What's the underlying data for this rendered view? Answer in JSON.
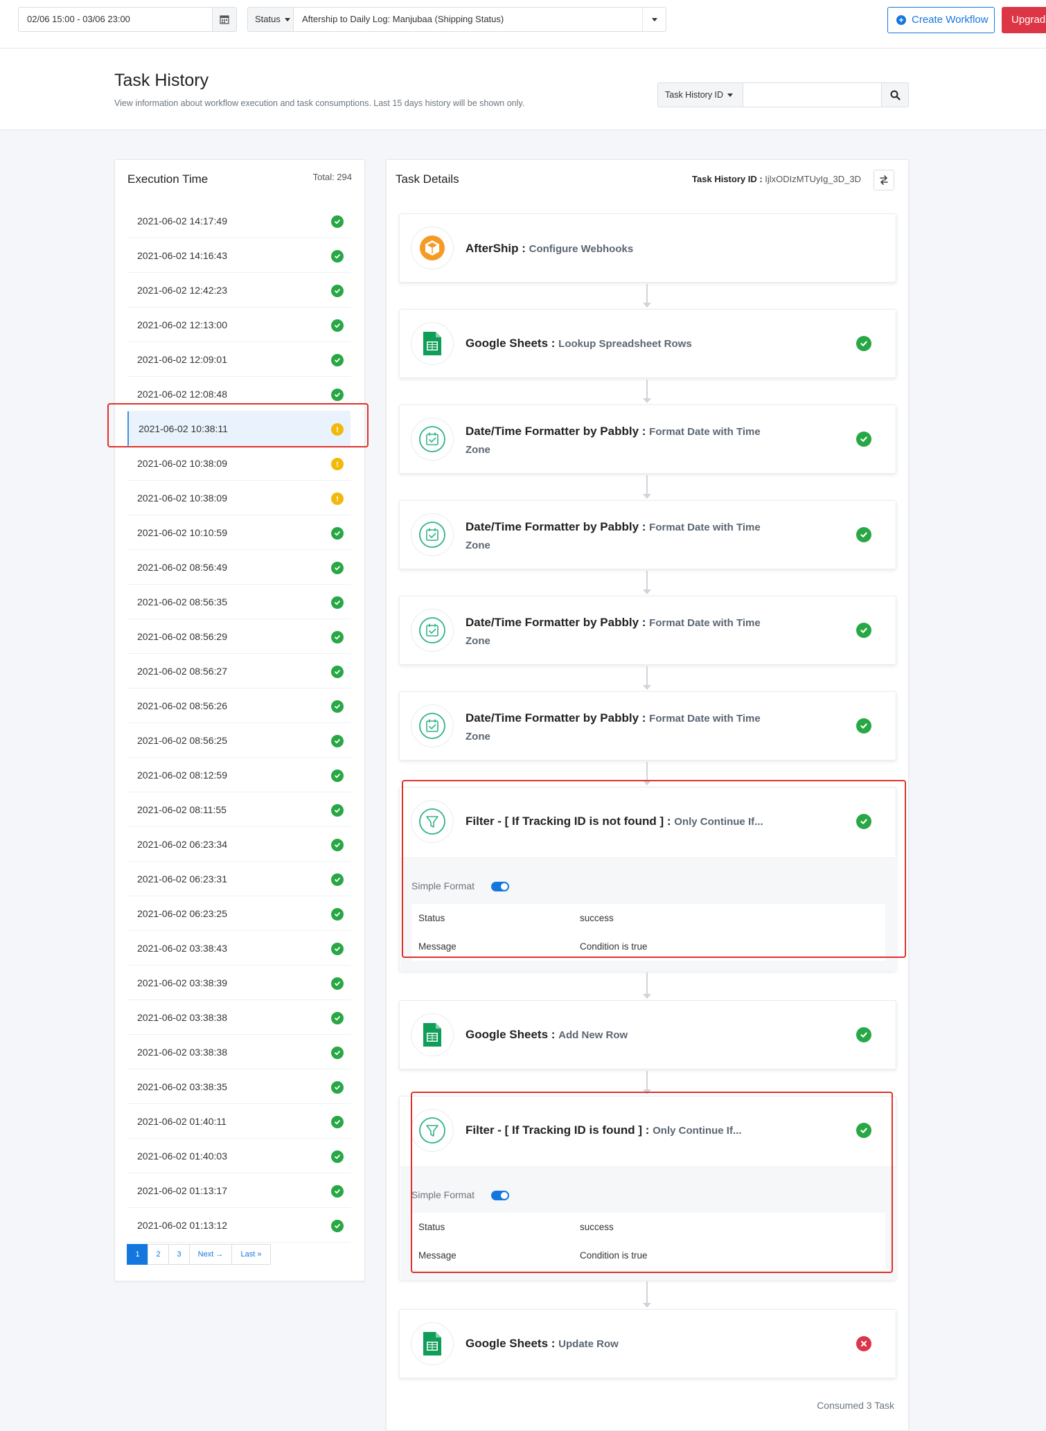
{
  "topbar": {
    "date_range": "02/06 15:00 - 03/06 23:00",
    "status_label": "Status",
    "workflow_selected": "Aftership to Daily Log: Manjubaa (Shipping Status)",
    "create_workflow_label": "Create Workflow",
    "upgrade_label": "Upgrad"
  },
  "header": {
    "title": "Task History",
    "subtitle": "View information about workflow execution and task consumptions. Last 15 days history will be shown only.",
    "search_type_label": "Task History ID",
    "search_value": ""
  },
  "executions": {
    "title": "Execution Time",
    "total": "Total: 294",
    "rows": [
      {
        "time": "2021-06-02 14:17:49",
        "status": "success"
      },
      {
        "time": "2021-06-02 14:16:43",
        "status": "success"
      },
      {
        "time": "2021-06-02 12:42:23",
        "status": "success"
      },
      {
        "time": "2021-06-02 12:13:00",
        "status": "success"
      },
      {
        "time": "2021-06-02 12:09:01",
        "status": "success"
      },
      {
        "time": "2021-06-02 12:08:48",
        "status": "success"
      },
      {
        "time": "2021-06-02 10:38:11",
        "status": "warning",
        "selected": true
      },
      {
        "time": "2021-06-02 10:38:09",
        "status": "warning"
      },
      {
        "time": "2021-06-02 10:38:09",
        "status": "warning"
      },
      {
        "time": "2021-06-02 10:10:59",
        "status": "success"
      },
      {
        "time": "2021-06-02 08:56:49",
        "status": "success"
      },
      {
        "time": "2021-06-02 08:56:35",
        "status": "success"
      },
      {
        "time": "2021-06-02 08:56:29",
        "status": "success"
      },
      {
        "time": "2021-06-02 08:56:27",
        "status": "success"
      },
      {
        "time": "2021-06-02 08:56:26",
        "status": "success"
      },
      {
        "time": "2021-06-02 08:56:25",
        "status": "success"
      },
      {
        "time": "2021-06-02 08:12:59",
        "status": "success"
      },
      {
        "time": "2021-06-02 08:11:55",
        "status": "success"
      },
      {
        "time": "2021-06-02 06:23:34",
        "status": "success"
      },
      {
        "time": "2021-06-02 06:23:31",
        "status": "success"
      },
      {
        "time": "2021-06-02 06:23:25",
        "status": "success"
      },
      {
        "time": "2021-06-02 03:38:43",
        "status": "success"
      },
      {
        "time": "2021-06-02 03:38:39",
        "status": "success"
      },
      {
        "time": "2021-06-02 03:38:38",
        "status": "success"
      },
      {
        "time": "2021-06-02 03:38:38",
        "status": "success"
      },
      {
        "time": "2021-06-02 03:38:35",
        "status": "success"
      },
      {
        "time": "2021-06-02 01:40:11",
        "status": "success"
      },
      {
        "time": "2021-06-02 01:40:03",
        "status": "success"
      },
      {
        "time": "2021-06-02 01:13:17",
        "status": "success"
      },
      {
        "time": "2021-06-02 01:13:12",
        "status": "success"
      }
    ],
    "pagination": {
      "pages": [
        "1",
        "2",
        "3"
      ],
      "active": "1",
      "next_label": "Next",
      "last_label": "Last"
    }
  },
  "task_details": {
    "title": "Task Details",
    "task_history_id_label": "Task History ID :",
    "task_history_id": "IjlxODIzMTUyIg_3D_3D",
    "consumed": "Consumed 3 Task",
    "steps": [
      {
        "app": "AfterShip :",
        "action": "Configure Webhooks",
        "icon": "aftership-icon",
        "status": "none"
      },
      {
        "app": "Google Sheets :",
        "action": "Lookup Spreadsheet Rows",
        "icon": "google-sheets-icon",
        "status": "success"
      },
      {
        "app": "Date/Time Formatter by Pabbly :",
        "action": "Format Date with Time Zone",
        "icon": "calendar-check-icon",
        "status": "success"
      },
      {
        "app": "Date/Time Formatter by Pabbly :",
        "action": "Format Date with Time Zone",
        "icon": "calendar-check-icon",
        "status": "success"
      },
      {
        "app": "Date/Time Formatter by Pabbly :",
        "action": "Format Date with Time Zone",
        "icon": "calendar-check-icon",
        "status": "success"
      },
      {
        "app": "Date/Time Formatter by Pabbly :",
        "action": "Format Date with Time Zone",
        "icon": "calendar-check-icon",
        "status": "success"
      },
      {
        "app": "Filter - [ If Tracking ID is not found ] :",
        "action": "Only Continue If...",
        "icon": "filter-icon",
        "status": "success",
        "detail": {
          "format_label": "Simple Format",
          "rows": [
            {
              "key": "Status",
              "value": "success"
            },
            {
              "key": "Message",
              "value": "Condition is true"
            }
          ]
        }
      },
      {
        "app": "Google Sheets :",
        "action": "Add New Row",
        "icon": "google-sheets-icon",
        "status": "success"
      },
      {
        "app": "Filter - [ If Tracking ID is found ] :",
        "action": "Only Continue If...",
        "icon": "filter-icon",
        "status": "success",
        "detail": {
          "format_label": "Simple Format",
          "rows": [
            {
              "key": "Status",
              "value": "success"
            },
            {
              "key": "Message",
              "value": "Condition is true"
            }
          ]
        }
      },
      {
        "app": "Google Sheets :",
        "action": "Update Row",
        "icon": "google-sheets-icon",
        "status": "error"
      }
    ]
  },
  "colors": {
    "primary": "#1477e0",
    "success": "#28a745",
    "warning": "#f2b90a",
    "error": "#dc3545",
    "highlight": "#e0302a"
  }
}
